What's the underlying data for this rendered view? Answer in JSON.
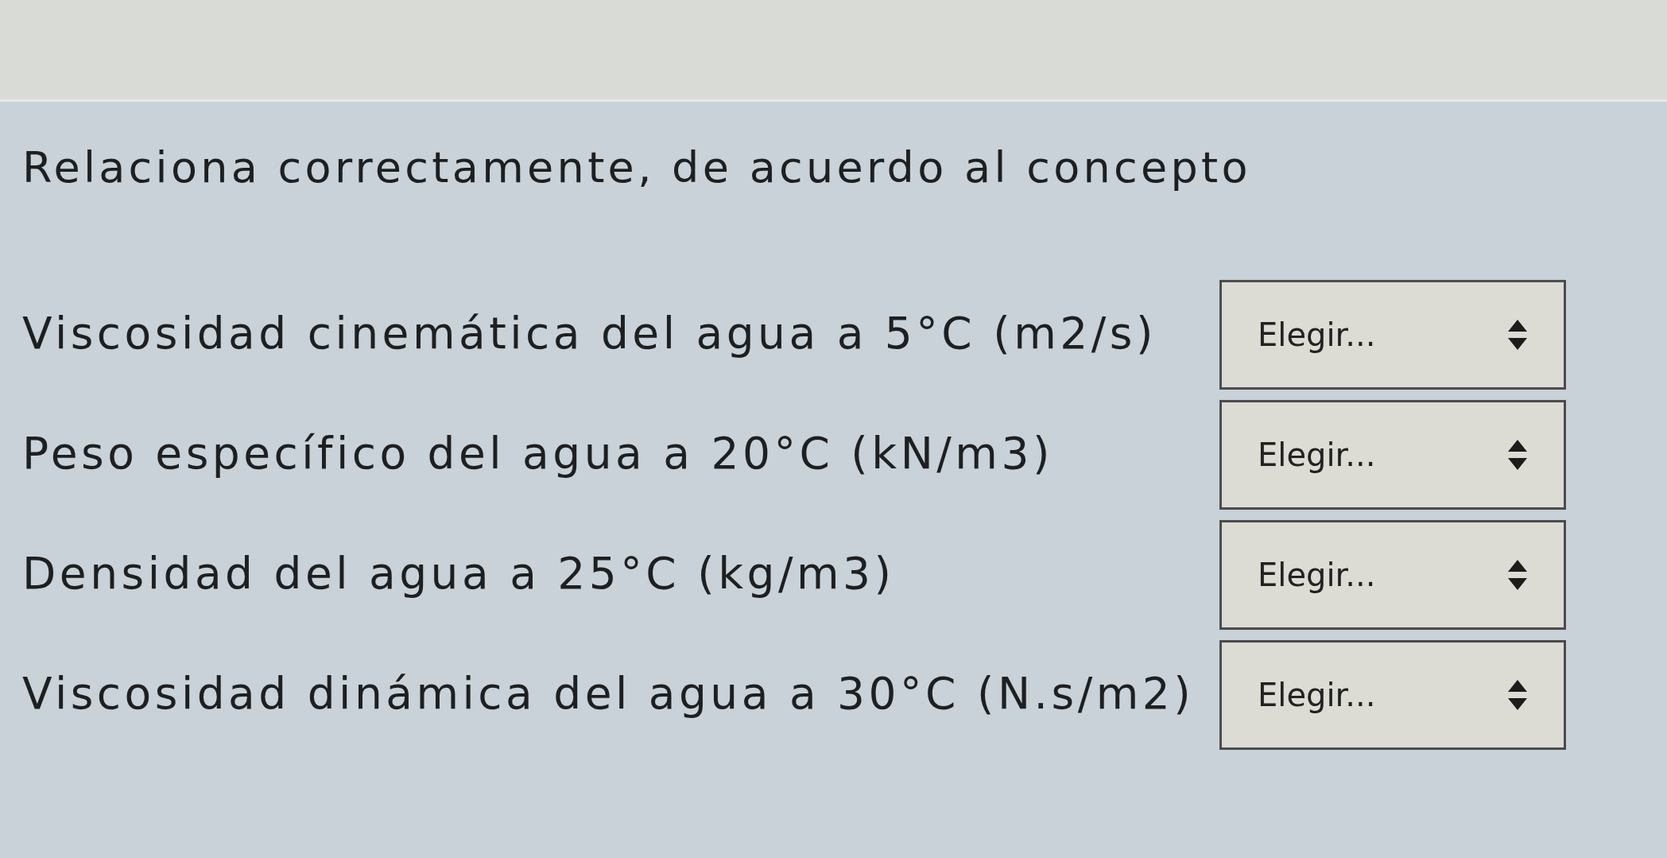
{
  "question": {
    "prompt": "Relaciona correctamente, de acuerdo al concepto",
    "items": [
      {
        "label": "Viscosidad cinemática del agua a 5°C (m2/s)",
        "select": {
          "value": "Elegir..."
        }
      },
      {
        "label": "Peso específico del agua a 20°C (kN/m3)",
        "select": {
          "value": "Elegir..."
        }
      },
      {
        "label": "Densidad del agua a 25°C (kg/m3)",
        "select": {
          "value": "Elegir..."
        }
      },
      {
        "label": "Viscosidad dinámica del agua a 30°C (N.s/m2)",
        "select": {
          "value": "Elegir..."
        }
      }
    ]
  }
}
